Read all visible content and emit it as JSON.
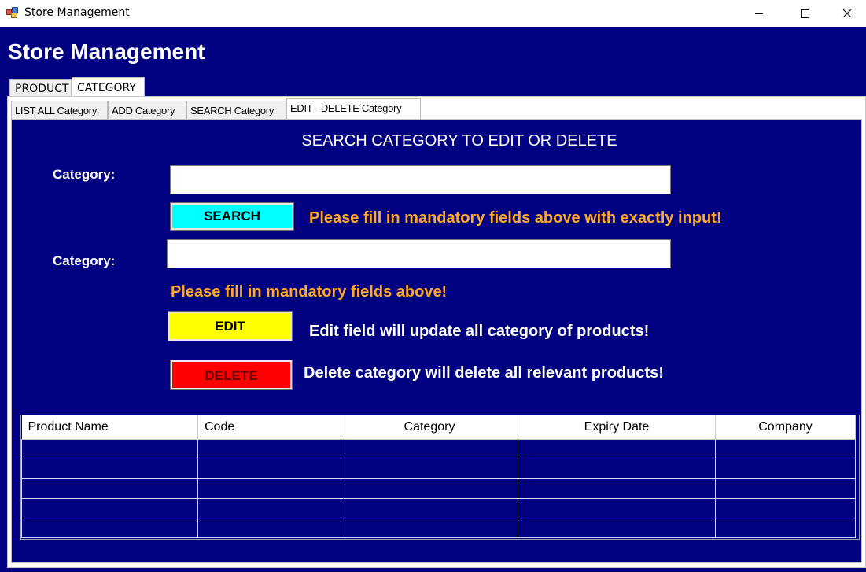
{
  "window": {
    "title": "Store Management",
    "icon": "app-icon",
    "controls": [
      "minimize-icon",
      "maximize-icon",
      "close-icon"
    ]
  },
  "app": {
    "heading": "Store Management"
  },
  "outer_tabs": [
    {
      "label": "PRODUCT",
      "selected": false
    },
    {
      "label": "CATEGORY",
      "selected": true
    }
  ],
  "inner_tabs": [
    {
      "label": "LIST ALL Category",
      "selected": false
    },
    {
      "label": "ADD Category",
      "selected": false
    },
    {
      "label": "SEARCH Category",
      "selected": false
    },
    {
      "label": "EDIT - DELETE Category",
      "selected": true
    }
  ],
  "form": {
    "section_title": "SEARCH CATEGORY TO EDIT OR DELETE",
    "search_label": "Category:",
    "search_value": "",
    "search_button": "SEARCH",
    "search_hint": "Please fill in mandatory fields above with exactly input!",
    "edit_label": "Category:",
    "edit_value": "",
    "edit_hint": "Please fill in mandatory fields above!",
    "edit_button": "EDIT",
    "edit_note": "Edit field will update all category of products!",
    "delete_button": "DELETE",
    "delete_note": "Delete category will delete all relevant products!"
  },
  "grid": {
    "columns": [
      "Product Name",
      "Code",
      "Category",
      "Expiry Date",
      "Company"
    ],
    "rows": [
      [
        "",
        "",
        "",
        "",
        ""
      ],
      [
        "",
        "",
        "",
        "",
        ""
      ],
      [
        "",
        "",
        "",
        "",
        ""
      ],
      [
        "",
        "",
        "",
        "",
        ""
      ],
      [
        "",
        "",
        "",
        "",
        ""
      ]
    ]
  },
  "colors": {
    "background": "#000080",
    "search_button": "#00ffff",
    "edit_button": "#ffff00",
    "delete_button": "#ff0000",
    "warning_text": "#ffa726"
  }
}
